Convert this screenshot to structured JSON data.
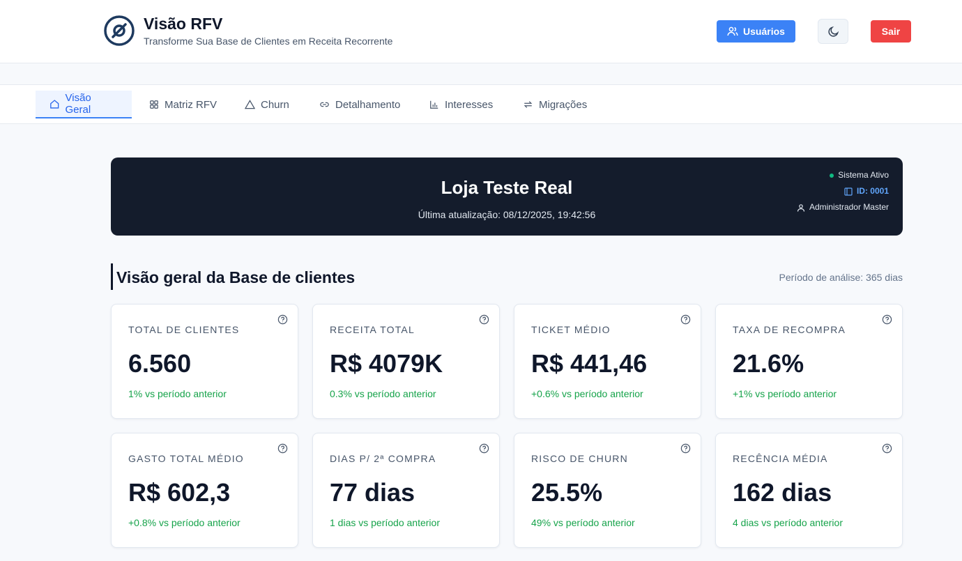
{
  "header": {
    "title": "Visão RFV",
    "subtitle": "Transforme Sua Base de Clientes em Receita Recorrente",
    "users_label": "Usuários",
    "exit_label": "Sair"
  },
  "tabs": [
    {
      "label": "Visão Geral",
      "icon": "home-icon",
      "active": true
    },
    {
      "label": "Matriz RFV",
      "icon": "grid-icon"
    },
    {
      "label": "Churn",
      "icon": "warning-icon"
    },
    {
      "label": "Detalhamento",
      "icon": "link-icon"
    },
    {
      "label": "Interesses",
      "icon": "bar-chart-icon"
    },
    {
      "label": "Migrações",
      "icon": "swap-icon"
    }
  ],
  "hero": {
    "store_name": "Loja Teste Real",
    "last_update": "Última atualização: 08/12/2025, 19:42:56",
    "status": "Sistema Ativo",
    "id": "ID: 0001",
    "user": "Administrador Master"
  },
  "overview": {
    "title": "Visão geral da Base de clientes",
    "period": "Período de análise: 365 dias"
  },
  "metrics": [
    {
      "label": "TOTAL DE CLIENTES",
      "value": "6.560",
      "delta": "1% vs período anterior"
    },
    {
      "label": "RECEITA TOTAL",
      "value": "R$ 4079K",
      "delta": "0.3% vs período anterior"
    },
    {
      "label": "TICKET MÉDIO",
      "value": "R$ 441,46",
      "delta": "+0.6% vs período anterior"
    },
    {
      "label": "TAXA DE RECOMPRA",
      "value": "21.6%",
      "delta": "+1% vs período anterior"
    },
    {
      "label": "GASTO TOTAL MÉDIO",
      "value": "R$ 602,3",
      "delta": "+0.8% vs período anterior"
    },
    {
      "label": "DIAS P/ 2ª COMPRA",
      "value": "77 dias",
      "delta": "1 dias vs período anterior"
    },
    {
      "label": "RISCO DE CHURN",
      "value": "25.5%",
      "delta": "49% vs período anterior"
    },
    {
      "label": "RECÊNCIA MÉDIA",
      "value": "162 dias",
      "delta": "4 dias vs período anterior"
    }
  ],
  "colors": {
    "accent": "#3b82f6",
    "danger": "#ef4444",
    "positive": "#16a34a",
    "hero_bg": "#141c2c"
  }
}
